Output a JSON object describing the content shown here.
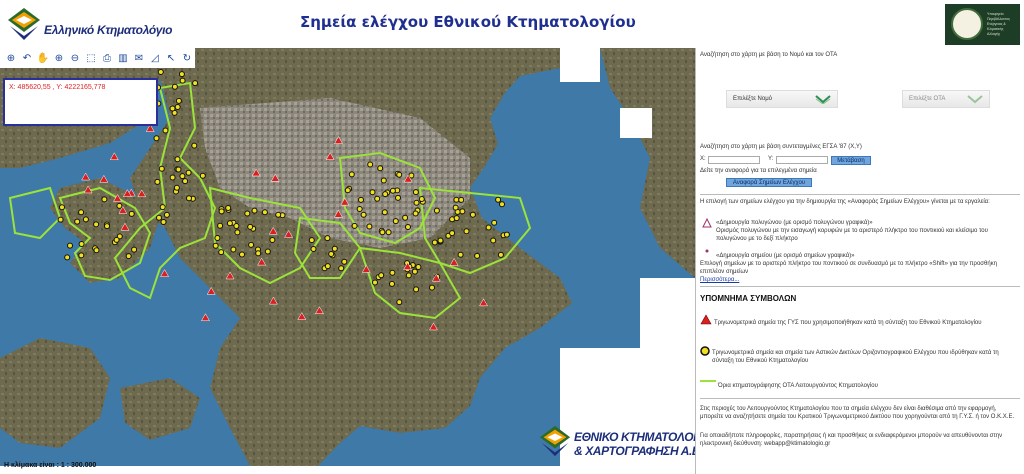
{
  "header": {
    "left_logo_text": "Ελληνικό Κτηματολόγιο",
    "title": "Σημεία ελέγχου Εθνικού Κτηματολογίου",
    "right_logo_text": "Υπουργείο Περιβάλλοντος Ενέργειας & Κλιματικής Αλλαγής"
  },
  "toolbar": {
    "tools": [
      "zoom-in-full-icon",
      "pan-hand-icon",
      "grab-hand-icon",
      "zoom-in-icon",
      "zoom-out-icon",
      "zoom-box-icon",
      "print-icon",
      "measure-icon",
      "mail-icon",
      "polygon-icon",
      "arrow-icon",
      "refresh-icon"
    ]
  },
  "map": {
    "coords": "X: 485620,55 , Y: 4222165,778",
    "scale": "Η κλίμακα είναι : 1 : 300.000",
    "bottom_logo_line1": "ΕΘΝΙΚΟ ΚΤΗΜΑΤΟΛΟΓΙΟ",
    "bottom_logo_line2": "& ΧΑΡΤΟΓΡΑΦΗΣΗ Α.Ε."
  },
  "panel": {
    "search_nomos_text": "Αναζήτηση στο χάρτη με βάση το Νομό και τον ΟΤΑ",
    "select_nomos": "Επιλέξτε Νομό",
    "select_ota": "Επιλέξτε ΟΤΑ",
    "search_coords_text": "Αναζήτηση στο χάρτη με βάση συντεταγμένες ΕΓΣΑ '87 (Χ,Υ)",
    "x_label": "X:",
    "y_label": "Y:",
    "go_button": "Μετάβαση",
    "report_hint": "Δείτε την αναφορά για τα επιλεγμένα σημεία",
    "report_button": "Αναφορά Σημείων Ελέγχου",
    "selection_intro": "Η επιλογή των σημείων ελέγχου για την δημιουργία της «Αναφοράς Σημείων Ελέγχου» γίνεται με τα εργαλεία:",
    "polygon_tool_title": "«Δημιουργία πολυγώνου (με ορισμό πολυγώνου γραφικά)»",
    "polygon_tool_desc": "Ορισμός πολυγώνου με την εισαγωγή κορυφών με το αριστερό πλήκτρο του ποντικιού και κλείσιμο του πολυγώνου με το δεξί πλήκτρο",
    "point_tool_title": "«Δημιουργία σημείου (με ορισμό σημείων γραφικά)»",
    "point_tool_desc": "Επιλογή σημείων με το αριστερό πλήκτρο του ποντικιού σε συνδυασμό με το πλήκτρο «Shift» για την προσθήκη επιπλέον σημείων",
    "more_link": "Περισσότερα...",
    "legend_title": "ΥΠΟΜΝΗΜΑ ΣΥΜΒΟΛΩΝ",
    "legend_triangle": "Τριγωνομετρικά σημεία της ΓΥΣ που χρησιμοποιήθηκαν κατά τη σύνταξη του Εθνικού Κτηματολογίου",
    "legend_point": "Τριγωνομετρικά σημεία και σημεία των Αστικών Δικτύων Οριζοντιογραφικού Ελέγχου που ιδρύθηκαν κατά τη σύνταξη του Εθνικού Κτηματολογίου",
    "legend_line": "Όρια κτηματογράφησης ΟΤΑ Λειτουργούντος Κτηματολογίου",
    "footer_text1": "Στις περιοχές του Λειτουργούντος Κτηματολογίου που τα σημεία ελέγχου δεν είναι διαθέσιμα από την εφαρμογή, μπορείτε να αναζητήσετε σημεία του Κρατικού Τριγωνομετρικού Δικτύου που χορηγούνται από τη Γ.Υ.Σ. ή τον Ο.Κ.Χ.Ε.",
    "footer_text2": "Για οποιαδήποτε πληροφορίες, παρατηρήσεις ή και προσθήκες οι ενδιαφερόμενοι μπορούν να απευθύνονται στην ηλεκτρονική διεύθυνση: webapp@ktimatologio.gr"
  },
  "colors": {
    "title_blue": "#1f2f8f",
    "boundary_green": "#9be33a",
    "triangle_red": "#d82020",
    "point_yellow": "#f0e020"
  }
}
